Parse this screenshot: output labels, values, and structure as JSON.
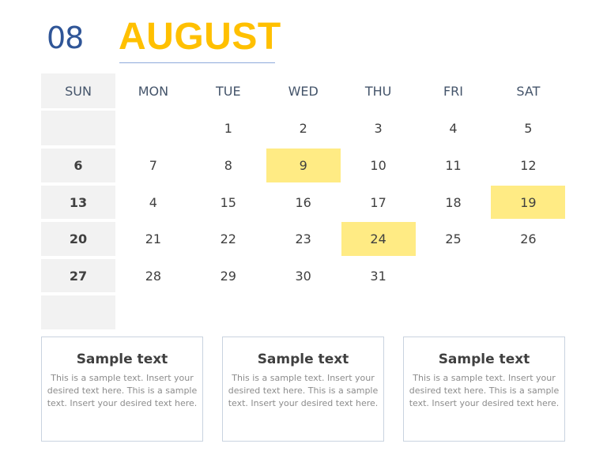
{
  "header": {
    "month_number": "08",
    "month_name": "AUGUST"
  },
  "colors": {
    "month_number": "#2f5597",
    "month_name": "#ffc000",
    "highlight": "#ffeb84",
    "sunday_column": "#f2f2f2"
  },
  "calendar": {
    "weekdays": [
      "SUN",
      "MON",
      "TUE",
      "WED",
      "THU",
      "FRI",
      "SAT"
    ],
    "weeks": [
      [
        "",
        "",
        "1",
        "2",
        "3",
        "4",
        "5"
      ],
      [
        "6",
        "7",
        "8",
        "9",
        "10",
        "11",
        "12"
      ],
      [
        "13",
        "4",
        "15",
        "16",
        "17",
        "18",
        "19"
      ],
      [
        "20",
        "21",
        "22",
        "23",
        "24",
        "25",
        "26"
      ],
      [
        "27",
        "28",
        "29",
        "30",
        "31",
        "",
        ""
      ],
      [
        "",
        "",
        "",
        "",
        "",
        "",
        ""
      ]
    ],
    "highlighted_dates": [
      "9",
      "19",
      "24"
    ]
  },
  "text_boxes": [
    {
      "title": "Sample text",
      "body": "This is a sample text. Insert your desired text here. This is a sample text. Insert your desired text here."
    },
    {
      "title": "Sample text",
      "body": "This is a sample text. Insert your desired text here. This is a sample text. Insert your desired text here."
    },
    {
      "title": "Sample text",
      "body": "This is a sample text. Insert your desired text here. This is a sample text. Insert your desired text here."
    }
  ]
}
